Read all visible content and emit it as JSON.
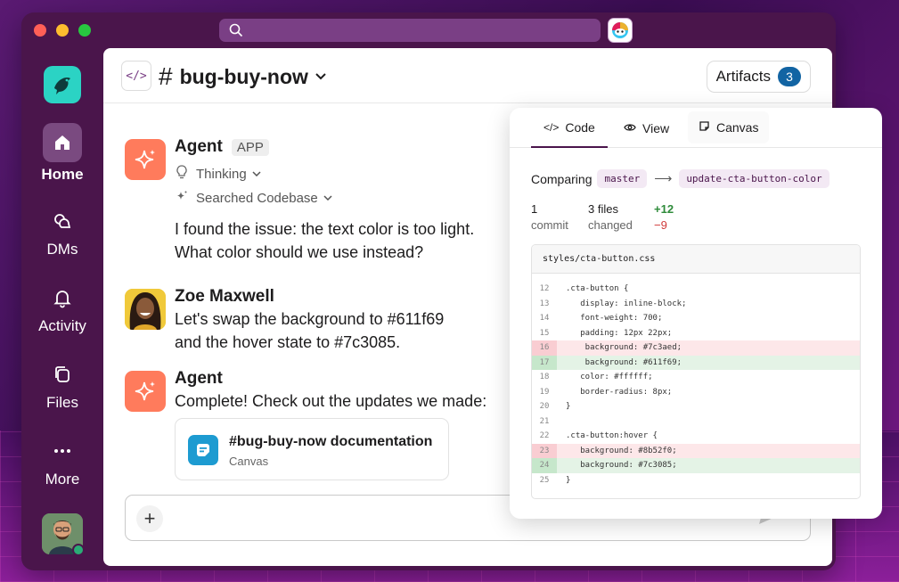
{
  "window": {
    "assistant_icon": "assistant-icon"
  },
  "sidebar": {
    "items": [
      {
        "label": "Home",
        "icon": "home-icon"
      },
      {
        "label": "DMs",
        "icon": "dms-icon"
      },
      {
        "label": "Activity",
        "icon": "bell-icon"
      },
      {
        "label": "Files",
        "icon": "files-icon"
      },
      {
        "label": "More",
        "icon": "more-icon"
      }
    ]
  },
  "header": {
    "channel_name": "bug-buy-now",
    "hash": "#",
    "code_chip": "</>",
    "artifacts_label": "Artifacts",
    "artifacts_count": "3"
  },
  "messages": [
    {
      "sender": "Agent",
      "badge": "APP",
      "thinking": "Thinking",
      "searched": "Searched Codebase",
      "text_line1": "I found the issue: the text color is too light.",
      "text_line2": "What color should we use instead?"
    },
    {
      "sender": "Zoe Maxwell",
      "text_line1": "Let's swap the background to #611f69",
      "text_line2": "and the hover state to #7c3085."
    },
    {
      "sender": "Agent",
      "text_line1": "Complete! Check out the updates we made:",
      "card_title": "#bug-buy-now documentation",
      "card_subtitle": "Canvas"
    }
  ],
  "composer": {
    "add_symbol": "+"
  },
  "artifact_panel": {
    "tabs": [
      {
        "label": "Code",
        "icon": "</>"
      },
      {
        "label": "View",
        "icon": "eye-icon"
      },
      {
        "label": "Canvas",
        "icon": "canvas-icon"
      }
    ],
    "comparing_label": "Comparing",
    "base_branch": "master",
    "arrow": "⟶",
    "head_branch": "update-cta-button-color",
    "stats": {
      "commit_count": "1",
      "commit_label": "commit",
      "files_count": "3 files",
      "files_label": "changed",
      "additions": "+12",
      "deletions": "−9"
    },
    "file_name": "styles/cta-button.css",
    "diff": [
      {
        "ln": "12",
        "code": ".cta-button {",
        "type": "ctx"
      },
      {
        "ln": "13",
        "code": "   display: inline-block;",
        "type": "ctx"
      },
      {
        "ln": "14",
        "code": "   font-weight: 700;",
        "type": "ctx"
      },
      {
        "ln": "15",
        "code": "   padding: 12px 22px;",
        "type": "ctx"
      },
      {
        "ln": "16",
        "code": "    background: #7c3aed;",
        "type": "del"
      },
      {
        "ln": "17",
        "code": "    background: #611f69;",
        "type": "add"
      },
      {
        "ln": "18",
        "code": "   color: #ffffff;",
        "type": "ctx"
      },
      {
        "ln": "19",
        "code": "   border-radius: 8px;",
        "type": "ctx"
      },
      {
        "ln": "20",
        "code": "}",
        "type": "ctx"
      },
      {
        "ln": "21",
        "code": "",
        "type": "ctx"
      },
      {
        "ln": "22",
        "code": ".cta-button:hover {",
        "type": "ctx"
      },
      {
        "ln": "23",
        "code": "   background: #8b52f0;",
        "type": "del"
      },
      {
        "ln": "24",
        "code": "   background: #7c3085;",
        "type": "add"
      },
      {
        "ln": "25",
        "code": "}",
        "type": "ctx"
      }
    ]
  },
  "colors": {
    "aubergine": "#4a154b",
    "accent_blue": "#1264a3",
    "agent_orange": "#ff7b5c",
    "addition_green": "#2e8b3a",
    "deletion_red": "#d03a3a"
  }
}
